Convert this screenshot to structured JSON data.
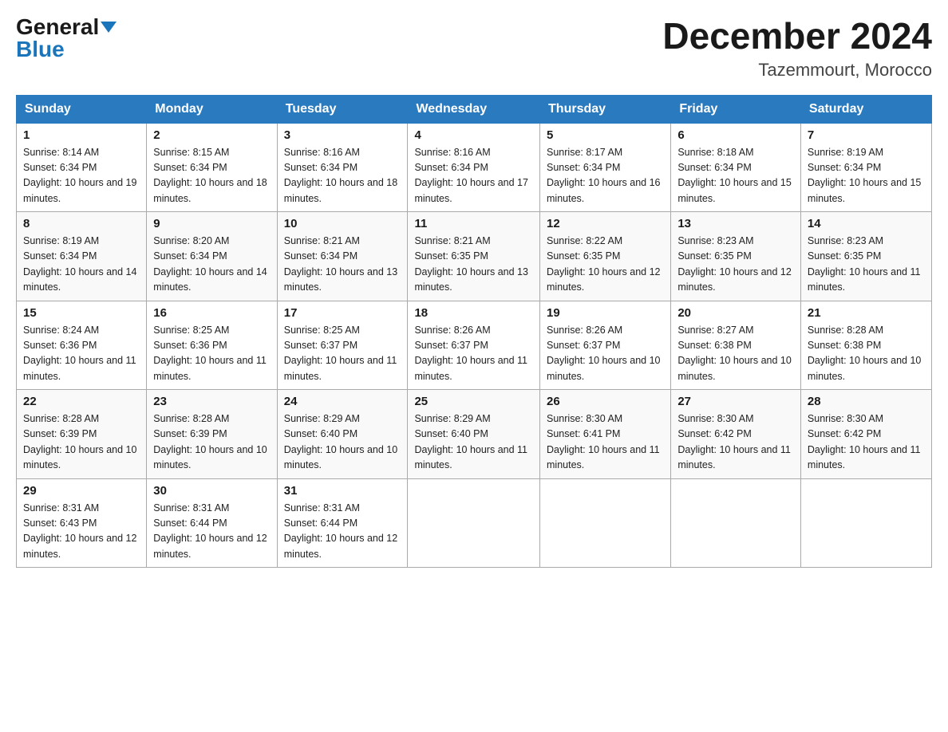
{
  "header": {
    "logo_general": "General",
    "logo_blue": "Blue",
    "month_title": "December 2024",
    "location": "Tazemmourt, Morocco"
  },
  "days_of_week": [
    "Sunday",
    "Monday",
    "Tuesday",
    "Wednesday",
    "Thursday",
    "Friday",
    "Saturday"
  ],
  "weeks": [
    [
      {
        "day": 1,
        "sunrise": "8:14 AM",
        "sunset": "6:34 PM",
        "daylight": "10 hours and 19 minutes."
      },
      {
        "day": 2,
        "sunrise": "8:15 AM",
        "sunset": "6:34 PM",
        "daylight": "10 hours and 18 minutes."
      },
      {
        "day": 3,
        "sunrise": "8:16 AM",
        "sunset": "6:34 PM",
        "daylight": "10 hours and 18 minutes."
      },
      {
        "day": 4,
        "sunrise": "8:16 AM",
        "sunset": "6:34 PM",
        "daylight": "10 hours and 17 minutes."
      },
      {
        "day": 5,
        "sunrise": "8:17 AM",
        "sunset": "6:34 PM",
        "daylight": "10 hours and 16 minutes."
      },
      {
        "day": 6,
        "sunrise": "8:18 AM",
        "sunset": "6:34 PM",
        "daylight": "10 hours and 15 minutes."
      },
      {
        "day": 7,
        "sunrise": "8:19 AM",
        "sunset": "6:34 PM",
        "daylight": "10 hours and 15 minutes."
      }
    ],
    [
      {
        "day": 8,
        "sunrise": "8:19 AM",
        "sunset": "6:34 PM",
        "daylight": "10 hours and 14 minutes."
      },
      {
        "day": 9,
        "sunrise": "8:20 AM",
        "sunset": "6:34 PM",
        "daylight": "10 hours and 14 minutes."
      },
      {
        "day": 10,
        "sunrise": "8:21 AM",
        "sunset": "6:34 PM",
        "daylight": "10 hours and 13 minutes."
      },
      {
        "day": 11,
        "sunrise": "8:21 AM",
        "sunset": "6:35 PM",
        "daylight": "10 hours and 13 minutes."
      },
      {
        "day": 12,
        "sunrise": "8:22 AM",
        "sunset": "6:35 PM",
        "daylight": "10 hours and 12 minutes."
      },
      {
        "day": 13,
        "sunrise": "8:23 AM",
        "sunset": "6:35 PM",
        "daylight": "10 hours and 12 minutes."
      },
      {
        "day": 14,
        "sunrise": "8:23 AM",
        "sunset": "6:35 PM",
        "daylight": "10 hours and 11 minutes."
      }
    ],
    [
      {
        "day": 15,
        "sunrise": "8:24 AM",
        "sunset": "6:36 PM",
        "daylight": "10 hours and 11 minutes."
      },
      {
        "day": 16,
        "sunrise": "8:25 AM",
        "sunset": "6:36 PM",
        "daylight": "10 hours and 11 minutes."
      },
      {
        "day": 17,
        "sunrise": "8:25 AM",
        "sunset": "6:37 PM",
        "daylight": "10 hours and 11 minutes."
      },
      {
        "day": 18,
        "sunrise": "8:26 AM",
        "sunset": "6:37 PM",
        "daylight": "10 hours and 11 minutes."
      },
      {
        "day": 19,
        "sunrise": "8:26 AM",
        "sunset": "6:37 PM",
        "daylight": "10 hours and 10 minutes."
      },
      {
        "day": 20,
        "sunrise": "8:27 AM",
        "sunset": "6:38 PM",
        "daylight": "10 hours and 10 minutes."
      },
      {
        "day": 21,
        "sunrise": "8:28 AM",
        "sunset": "6:38 PM",
        "daylight": "10 hours and 10 minutes."
      }
    ],
    [
      {
        "day": 22,
        "sunrise": "8:28 AM",
        "sunset": "6:39 PM",
        "daylight": "10 hours and 10 minutes."
      },
      {
        "day": 23,
        "sunrise": "8:28 AM",
        "sunset": "6:39 PM",
        "daylight": "10 hours and 10 minutes."
      },
      {
        "day": 24,
        "sunrise": "8:29 AM",
        "sunset": "6:40 PM",
        "daylight": "10 hours and 10 minutes."
      },
      {
        "day": 25,
        "sunrise": "8:29 AM",
        "sunset": "6:40 PM",
        "daylight": "10 hours and 11 minutes."
      },
      {
        "day": 26,
        "sunrise": "8:30 AM",
        "sunset": "6:41 PM",
        "daylight": "10 hours and 11 minutes."
      },
      {
        "day": 27,
        "sunrise": "8:30 AM",
        "sunset": "6:42 PM",
        "daylight": "10 hours and 11 minutes."
      },
      {
        "day": 28,
        "sunrise": "8:30 AM",
        "sunset": "6:42 PM",
        "daylight": "10 hours and 11 minutes."
      }
    ],
    [
      {
        "day": 29,
        "sunrise": "8:31 AM",
        "sunset": "6:43 PM",
        "daylight": "10 hours and 12 minutes."
      },
      {
        "day": 30,
        "sunrise": "8:31 AM",
        "sunset": "6:44 PM",
        "daylight": "10 hours and 12 minutes."
      },
      {
        "day": 31,
        "sunrise": "8:31 AM",
        "sunset": "6:44 PM",
        "daylight": "10 hours and 12 minutes."
      },
      null,
      null,
      null,
      null
    ]
  ],
  "labels": {
    "sunrise_prefix": "Sunrise: ",
    "sunset_prefix": "Sunset: ",
    "daylight_prefix": "Daylight: "
  }
}
